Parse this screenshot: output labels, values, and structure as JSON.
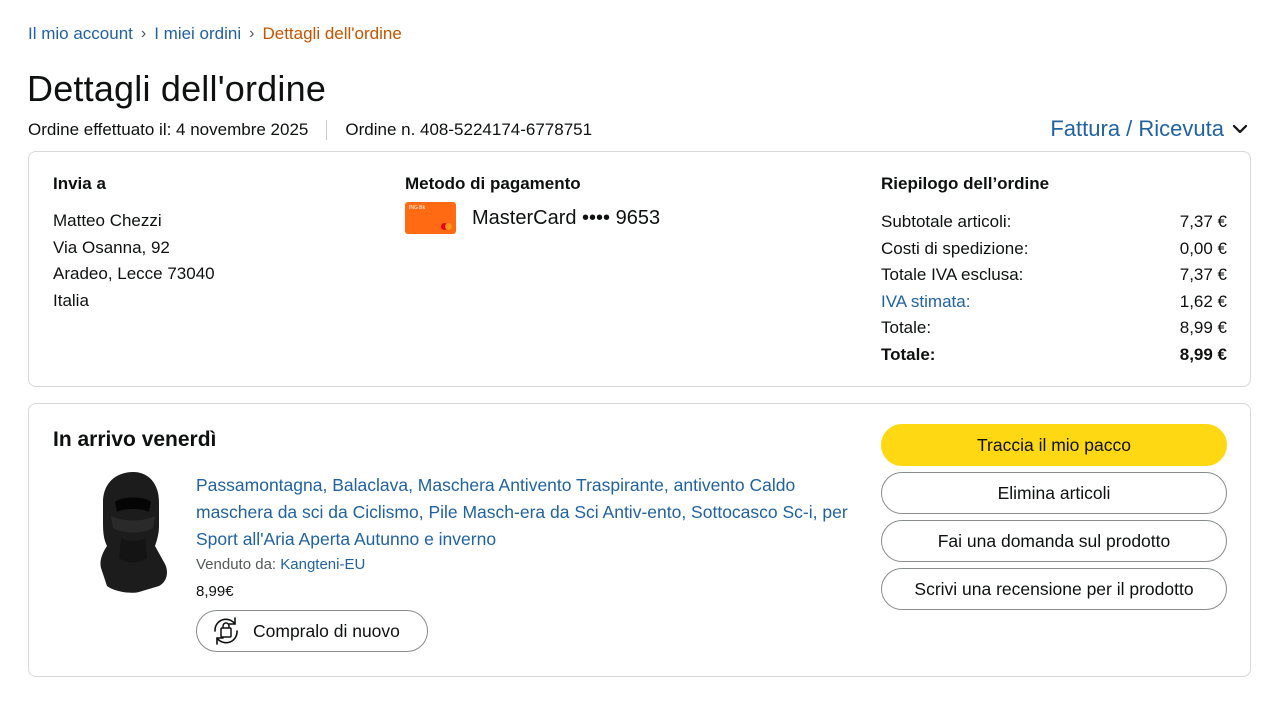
{
  "breadcrumb": {
    "items": [
      "Il mio account",
      "I miei ordini"
    ],
    "separator": "›",
    "current": "Dettagli dell'ordine"
  },
  "page": {
    "title": "Dettagli dell'ordine",
    "order_date": "Ordine effettuato il: 4 novembre 2025",
    "order_number": "Ordine n. 408-5224174-6778751",
    "invoice_link": "Fattura / Ricevuta"
  },
  "shipping": {
    "title": "Invia a",
    "name": "Matteo Chezzi",
    "street": "Via Osanna, 92",
    "city": "Aradeo, Lecce 73040",
    "country": "Italia"
  },
  "payment": {
    "title": "Metodo di pagamento",
    "method": "MasterCard •••• 9653"
  },
  "summary": {
    "title": "Riepilogo dell’ordine",
    "rows": [
      {
        "label": "Subtotale articoli:",
        "value": "7,37 €"
      },
      {
        "label": "Costi di spedizione:",
        "value": "0,00 €"
      },
      {
        "label": "Totale IVA esclusa:",
        "value": "7,37 €"
      },
      {
        "label": "IVA stimata:",
        "value": "1,62 €"
      },
      {
        "label": "Totale:",
        "value": "8,99 €"
      },
      {
        "label": "Totale:",
        "value": "8,99 €"
      }
    ]
  },
  "shipment": {
    "arrival": "In arrivo venerdì",
    "product_title": "Passamontagna, Balaclava, Maschera Antivento Traspirante, antivento Caldo maschera da sci da Ciclismo, Pile Masch-era da Sci Antiv-ento, Sottocasco Sc-i, per Sport all'Aria Aperta Autunno e inverno",
    "sold_by_label": "Venduto da:",
    "seller": "Kangteni-EU",
    "price": "8,99€",
    "buy_again": "Compralo di nuovo",
    "buttons": {
      "track": "Traccia il mio pacco",
      "delete": "Elimina articoli",
      "ask": "Fai una domanda sul prodotto",
      "review": "Scrivi una recensione per il prodotto"
    }
  },
  "colors": {
    "link": "#2162a1",
    "breadcrumb_current": "#c45500",
    "primary_button": "#ffd814",
    "border": "#d5d9d9"
  },
  "icons": {
    "invoice_dropdown": "chevron-down-icon",
    "payment_card": "mastercard-icon",
    "buy_again": "buy-again-icon"
  }
}
